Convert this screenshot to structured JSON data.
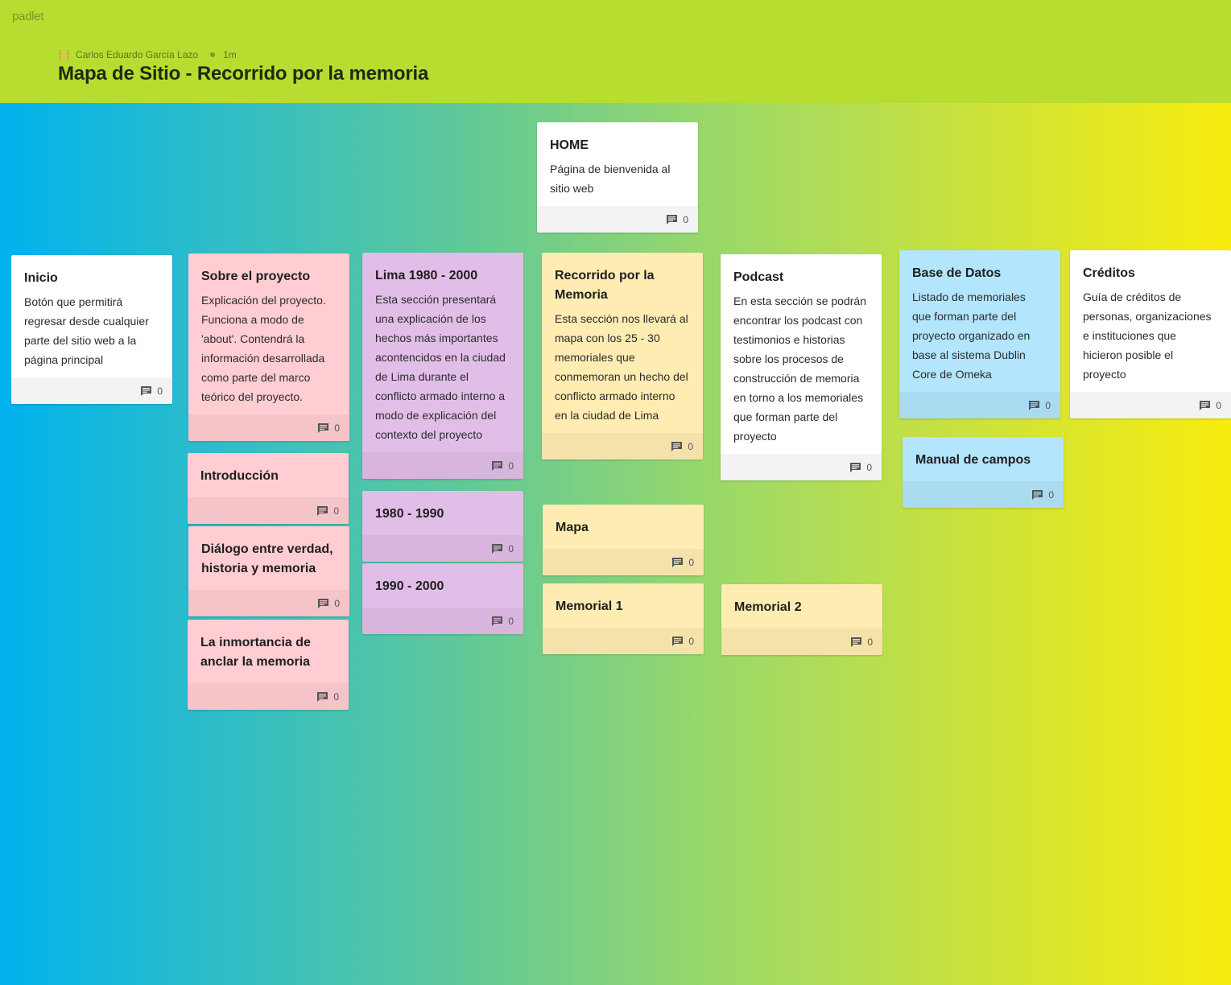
{
  "app": {
    "logo": "padlet"
  },
  "header": {
    "author": "Carlos Eduardo García Lazo",
    "time": "1m",
    "title": "Mapa de Sitio - Recorrido por la memoria"
  },
  "colors": {
    "header_bg": "#b6dd2f",
    "gradient_left": "#00b2ee",
    "gradient_right": "#f8ec0d",
    "card_white": "#ffffff",
    "card_pink": "#ffcdd2",
    "card_purple": "#e1bee7",
    "card_yellow": "#ffecb3",
    "card_blue": "#b3e5fc"
  },
  "icons": {
    "comment": "comment-icon",
    "avatar": "ladder-avatar-icon"
  },
  "cards": {
    "home": {
      "title": "HOME",
      "text": "Página de bienvenida al sitio web",
      "comments": "0"
    },
    "inicio": {
      "title": "Inicio",
      "text": "Botón que permitirá regresar desde cualquier parte del sitio web a la página principal",
      "comments": "0"
    },
    "sobre": {
      "title": "Sobre el proyecto",
      "text": "Explicación del proyecto. Funciona a modo de 'about'. Contendrá la información desarrollada como parte del marco teórico del proyecto.",
      "comments": "0"
    },
    "introduccion": {
      "title": "Introducción",
      "comments": "0"
    },
    "dialogo": {
      "title": "Diálogo entre verdad, historia y memoria",
      "comments": "0"
    },
    "inmortancia": {
      "title": "La inmortancia de anclar la memoria",
      "comments": "0"
    },
    "lima": {
      "title": "Lima 1980 - 2000",
      "text": "Esta sección presentará una explicación de los hechos más importantes acontencidos en la ciudad de Lima durante el conflicto armado interno a modo de explicación del contexto del proyecto",
      "comments": "0"
    },
    "d1980": {
      "title": "1980 - 1990",
      "comments": "0"
    },
    "d1990": {
      "title": "1990 - 2000",
      "comments": "0"
    },
    "recorrido": {
      "title": "Recorrido por la Memoria",
      "text": "Esta sección nos llevará al mapa con los 25 - 30 memoriales que conmemoran un hecho del conflicto armado interno en la ciudad de Lima",
      "comments": "0"
    },
    "mapa": {
      "title": "Mapa",
      "comments": "0"
    },
    "memorial1": {
      "title": "Memorial 1",
      "comments": "0"
    },
    "podcast": {
      "title": "Podcast",
      "text": "En esta sección se podrán encontrar los podcast con testimonios e historias sobre los procesos de construcción de memoria en torno a los memoriales que forman parte del proyecto",
      "comments": "0"
    },
    "memorial2": {
      "title": "Memorial 2",
      "comments": "0"
    },
    "basedatos": {
      "title": "Base de Datos",
      "text": "Listado de memoriales que forman parte del proyecto organizado en base al sistema Dublin Core de Omeka",
      "comments": "0"
    },
    "manual": {
      "title": "Manual de campos",
      "comments": "0"
    },
    "creditos": {
      "title": "Créditos",
      "text": "Guía de créditos de personas, organizaciones e instituciones que hicieron posible el proyecto",
      "comments": "0"
    }
  }
}
